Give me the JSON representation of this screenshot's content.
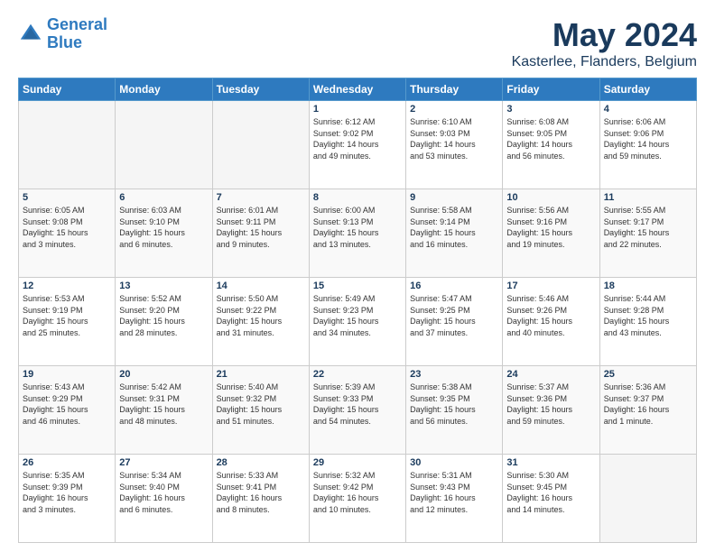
{
  "header": {
    "logo_line1": "General",
    "logo_line2": "Blue",
    "month_title": "May 2024",
    "location": "Kasterlee, Flanders, Belgium"
  },
  "days_of_week": [
    "Sunday",
    "Monday",
    "Tuesday",
    "Wednesday",
    "Thursday",
    "Friday",
    "Saturday"
  ],
  "weeks": [
    [
      {
        "day": "",
        "info": ""
      },
      {
        "day": "",
        "info": ""
      },
      {
        "day": "",
        "info": ""
      },
      {
        "day": "1",
        "info": "Sunrise: 6:12 AM\nSunset: 9:02 PM\nDaylight: 14 hours\nand 49 minutes."
      },
      {
        "day": "2",
        "info": "Sunrise: 6:10 AM\nSunset: 9:03 PM\nDaylight: 14 hours\nand 53 minutes."
      },
      {
        "day": "3",
        "info": "Sunrise: 6:08 AM\nSunset: 9:05 PM\nDaylight: 14 hours\nand 56 minutes."
      },
      {
        "day": "4",
        "info": "Sunrise: 6:06 AM\nSunset: 9:06 PM\nDaylight: 14 hours\nand 59 minutes."
      }
    ],
    [
      {
        "day": "5",
        "info": "Sunrise: 6:05 AM\nSunset: 9:08 PM\nDaylight: 15 hours\nand 3 minutes."
      },
      {
        "day": "6",
        "info": "Sunrise: 6:03 AM\nSunset: 9:10 PM\nDaylight: 15 hours\nand 6 minutes."
      },
      {
        "day": "7",
        "info": "Sunrise: 6:01 AM\nSunset: 9:11 PM\nDaylight: 15 hours\nand 9 minutes."
      },
      {
        "day": "8",
        "info": "Sunrise: 6:00 AM\nSunset: 9:13 PM\nDaylight: 15 hours\nand 13 minutes."
      },
      {
        "day": "9",
        "info": "Sunrise: 5:58 AM\nSunset: 9:14 PM\nDaylight: 15 hours\nand 16 minutes."
      },
      {
        "day": "10",
        "info": "Sunrise: 5:56 AM\nSunset: 9:16 PM\nDaylight: 15 hours\nand 19 minutes."
      },
      {
        "day": "11",
        "info": "Sunrise: 5:55 AM\nSunset: 9:17 PM\nDaylight: 15 hours\nand 22 minutes."
      }
    ],
    [
      {
        "day": "12",
        "info": "Sunrise: 5:53 AM\nSunset: 9:19 PM\nDaylight: 15 hours\nand 25 minutes."
      },
      {
        "day": "13",
        "info": "Sunrise: 5:52 AM\nSunset: 9:20 PM\nDaylight: 15 hours\nand 28 minutes."
      },
      {
        "day": "14",
        "info": "Sunrise: 5:50 AM\nSunset: 9:22 PM\nDaylight: 15 hours\nand 31 minutes."
      },
      {
        "day": "15",
        "info": "Sunrise: 5:49 AM\nSunset: 9:23 PM\nDaylight: 15 hours\nand 34 minutes."
      },
      {
        "day": "16",
        "info": "Sunrise: 5:47 AM\nSunset: 9:25 PM\nDaylight: 15 hours\nand 37 minutes."
      },
      {
        "day": "17",
        "info": "Sunrise: 5:46 AM\nSunset: 9:26 PM\nDaylight: 15 hours\nand 40 minutes."
      },
      {
        "day": "18",
        "info": "Sunrise: 5:44 AM\nSunset: 9:28 PM\nDaylight: 15 hours\nand 43 minutes."
      }
    ],
    [
      {
        "day": "19",
        "info": "Sunrise: 5:43 AM\nSunset: 9:29 PM\nDaylight: 15 hours\nand 46 minutes."
      },
      {
        "day": "20",
        "info": "Sunrise: 5:42 AM\nSunset: 9:31 PM\nDaylight: 15 hours\nand 48 minutes."
      },
      {
        "day": "21",
        "info": "Sunrise: 5:40 AM\nSunset: 9:32 PM\nDaylight: 15 hours\nand 51 minutes."
      },
      {
        "day": "22",
        "info": "Sunrise: 5:39 AM\nSunset: 9:33 PM\nDaylight: 15 hours\nand 54 minutes."
      },
      {
        "day": "23",
        "info": "Sunrise: 5:38 AM\nSunset: 9:35 PM\nDaylight: 15 hours\nand 56 minutes."
      },
      {
        "day": "24",
        "info": "Sunrise: 5:37 AM\nSunset: 9:36 PM\nDaylight: 15 hours\nand 59 minutes."
      },
      {
        "day": "25",
        "info": "Sunrise: 5:36 AM\nSunset: 9:37 PM\nDaylight: 16 hours\nand 1 minute."
      }
    ],
    [
      {
        "day": "26",
        "info": "Sunrise: 5:35 AM\nSunset: 9:39 PM\nDaylight: 16 hours\nand 3 minutes."
      },
      {
        "day": "27",
        "info": "Sunrise: 5:34 AM\nSunset: 9:40 PM\nDaylight: 16 hours\nand 6 minutes."
      },
      {
        "day": "28",
        "info": "Sunrise: 5:33 AM\nSunset: 9:41 PM\nDaylight: 16 hours\nand 8 minutes."
      },
      {
        "day": "29",
        "info": "Sunrise: 5:32 AM\nSunset: 9:42 PM\nDaylight: 16 hours\nand 10 minutes."
      },
      {
        "day": "30",
        "info": "Sunrise: 5:31 AM\nSunset: 9:43 PM\nDaylight: 16 hours\nand 12 minutes."
      },
      {
        "day": "31",
        "info": "Sunrise: 5:30 AM\nSunset: 9:45 PM\nDaylight: 16 hours\nand 14 minutes."
      },
      {
        "day": "",
        "info": ""
      }
    ]
  ]
}
